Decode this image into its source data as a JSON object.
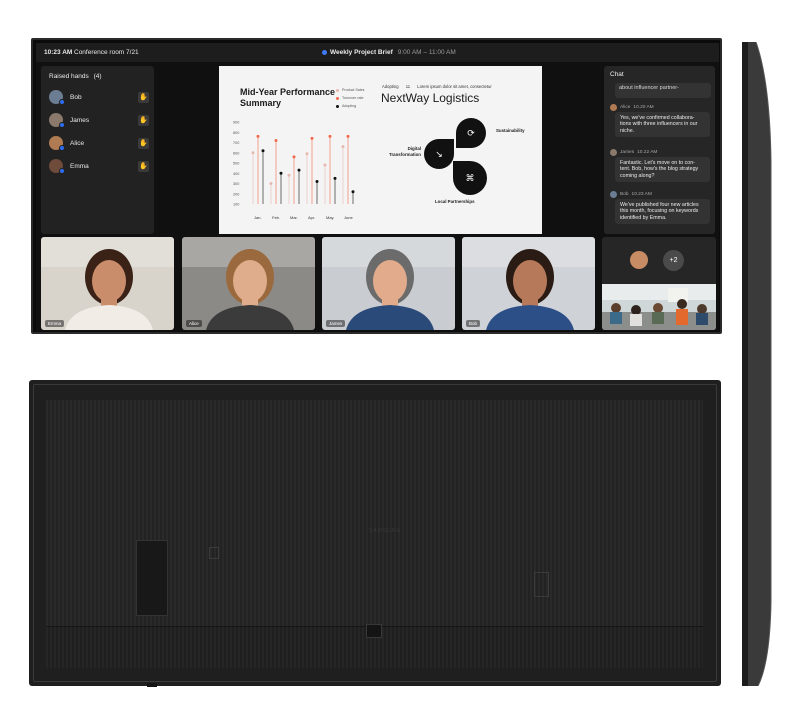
{
  "topbar": {
    "time": "10:23 AM",
    "room": "Conference room 7/21",
    "meeting_title": "Weekly Project Brief",
    "meeting_time": "9:00 AM – 11:00 AM"
  },
  "raised_hands": {
    "title": "Raised hands",
    "count": "(4)",
    "people": [
      {
        "name": "Bob",
        "avatar_color": "#6b7d93"
      },
      {
        "name": "James",
        "avatar_color": "#8b7a6b"
      },
      {
        "name": "Alice",
        "avatar_color": "#b07b52"
      },
      {
        "name": "Emma",
        "avatar_color": "#6e4b3a"
      }
    ]
  },
  "slide": {
    "title": "Mid-Year Performance Summary",
    "legend": [
      "Product Sales",
      "Turnover rate",
      "Adopting"
    ],
    "brand_tag": "Adopting",
    "brand_tag_num": "11",
    "brand_tag_text": "Lorem ipsum dolor sit amet, consectetur",
    "brand_name": "NextWay Logistics",
    "labels": {
      "sustainability": "Sustainability",
      "digital": "Digital Transformation",
      "local": "Local Partnerships"
    }
  },
  "chart_data": {
    "type": "line",
    "categories": [
      "Jan.",
      "Feb.",
      "Mar.",
      "Apr.",
      "May.",
      "June"
    ],
    "yticks": [
      900,
      800,
      700,
      600,
      500,
      400,
      300,
      200,
      100
    ],
    "ylim": [
      100,
      900
    ],
    "series": [
      {
        "name": "Product Sales",
        "color": "#e8b8b0",
        "values": [
          600,
          300,
          380,
          590,
          480,
          660
        ]
      },
      {
        "name": "Turnover rate",
        "color": "#f06a4d",
        "values": [
          760,
          720,
          560,
          740,
          760,
          760
        ]
      },
      {
        "name": "Adopting",
        "color": "#111111",
        "values": [
          620,
          400,
          430,
          320,
          350,
          220
        ]
      }
    ]
  },
  "chat": {
    "title": "Chat",
    "preview": "about influencer partner-",
    "messages": [
      {
        "author": "Alice",
        "time": "10.20 AM",
        "text": "Yes, we've confirmed collabora-tions with three influencers in our niche.",
        "color": "#b07b52"
      },
      {
        "author": "James",
        "time": "10.22 AM",
        "text": "Fantastic. Let's move on to con-tent. Bob, how's the blog strategy coming along?",
        "color": "#8b7a6b"
      },
      {
        "author": "Bob",
        "time": "10.23 AM",
        "text": "We've published four new articles this month, focusing on keywords identified by Emma.",
        "color": "#6b7d93"
      }
    ]
  },
  "video_tiles": [
    {
      "name": "Emma",
      "bg": "#d8d4cc",
      "skin": "#c98d6c",
      "hair": "#3b2217",
      "shirt": "#f1ede6"
    },
    {
      "name": "Alice",
      "bg": "#8c8a86",
      "skin": "#e0ad8c",
      "hair": "#9a6a3e",
      "shirt": "#3b3b3b"
    },
    {
      "name": "James",
      "bg": "#c9ccd0",
      "skin": "#e2ab8c",
      "hair": "#6b6b6b",
      "shirt": "#2a4a7a"
    },
    {
      "name": "Bob",
      "bg": "#cfd2d6",
      "skin": "#b67a5a",
      "hair": "#2a1c14",
      "shirt": "#2d4f88"
    }
  ],
  "overflow": {
    "count": "+2",
    "avatar_color": "#c78c63"
  },
  "back_panel": {
    "brand": "SAMSUNG"
  },
  "colors": {
    "accent": "#3d7bf7",
    "hand": "#f6c343"
  }
}
